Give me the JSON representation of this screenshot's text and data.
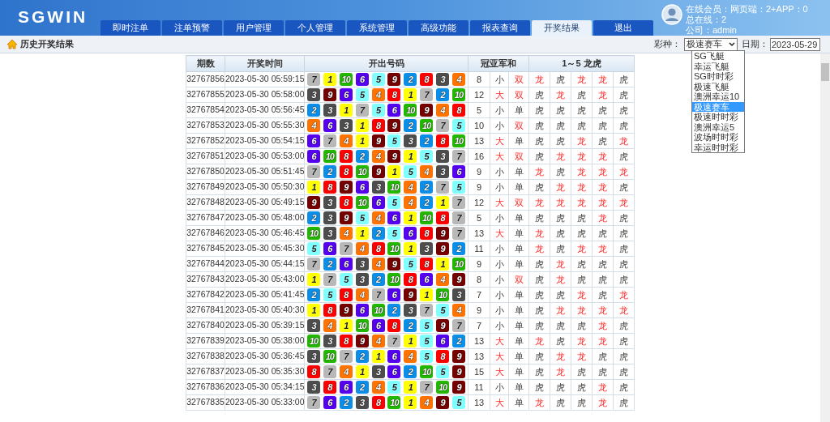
{
  "brand": {
    "logo": "SGWIN"
  },
  "nav_tabs": [
    {
      "label": "即时注单",
      "selected": false
    },
    {
      "label": "注单预警",
      "selected": false
    },
    {
      "label": "用户管理",
      "selected": false
    },
    {
      "label": "个人管理",
      "selected": false
    },
    {
      "label": "系统管理",
      "selected": false
    },
    {
      "label": "高级功能",
      "selected": false
    },
    {
      "label": "报表查询",
      "selected": false
    },
    {
      "label": "开奖结果",
      "selected": true
    },
    {
      "label": "退出",
      "selected": false
    }
  ],
  "user_info": [
    "在线会员：网页端：2+APP：0",
    "总在线：2",
    "公司：admin"
  ],
  "toolbar": {
    "title": "历史开奖结果",
    "lottery_label": "彩种：",
    "lottery_value": "极速赛车",
    "date_label": "日期：",
    "date_value": "2023-05-29"
  },
  "lottery_options": [
    {
      "label": "SG飞艇",
      "selected": false
    },
    {
      "label": "幸运飞艇",
      "selected": false
    },
    {
      "label": "SG时时彩",
      "selected": false
    },
    {
      "label": "极速飞艇",
      "selected": false
    },
    {
      "label": "澳洲幸运10",
      "selected": false
    },
    {
      "label": "极速赛车",
      "selected": true
    },
    {
      "label": "极速时时彩",
      "selected": false
    },
    {
      "label": "澳洲幸运5",
      "selected": false
    },
    {
      "label": "波场时时彩",
      "selected": false
    },
    {
      "label": "幸运时时彩",
      "selected": false
    }
  ],
  "table": {
    "columns": [
      "期数",
      "开奖时间",
      "开出号码",
      "冠亚军和",
      "1～5 龙虎"
    ],
    "rows": [
      {
        "issue": "32767856",
        "time": "2023-05-30 05:59:15",
        "balls": [
          {
            "label": "7",
            "color": "#b8b8b8"
          },
          {
            "label": "1",
            "color": "#ffff00"
          },
          {
            "label": "10",
            "color": "#22b800"
          },
          {
            "label": "6",
            "color": "#5500ee"
          },
          {
            "label": "5",
            "color": "#80ffff"
          },
          {
            "label": "9",
            "color": "#750000"
          },
          {
            "label": "2",
            "color": "#0b8ee8"
          },
          {
            "label": "8",
            "color": "#ff0000"
          },
          {
            "label": "3",
            "color": "#4d4d4d"
          },
          {
            "label": "4",
            "color": "#ff7300"
          }
        ],
        "sum": "8",
        "size": {
          "text": "小",
          "highlight": false
        },
        "parity": {
          "text": "双",
          "highlight": true
        },
        "dragon_tiger": [
          {
            "text": "龙",
            "highlight": true
          },
          {
            "text": "虎",
            "highlight": false
          },
          {
            "text": "龙",
            "highlight": true
          },
          {
            "text": "龙",
            "highlight": true
          },
          {
            "text": "虎",
            "highlight": false
          }
        ]
      },
      {
        "issue": "32767855",
        "time": "2023-05-30 05:58:00",
        "balls": [
          {
            "label": "3",
            "color": "#4d4d4d"
          },
          {
            "label": "9",
            "color": "#750000"
          },
          {
            "label": "6",
            "color": "#5500ee"
          },
          {
            "label": "5",
            "color": "#80ffff"
          },
          {
            "label": "4",
            "color": "#ff7300"
          },
          {
            "label": "8",
            "color": "#ff0000"
          },
          {
            "label": "1",
            "color": "#ffff00"
          },
          {
            "label": "7",
            "color": "#b8b8b8"
          },
          {
            "label": "2",
            "color": "#0b8ee8"
          },
          {
            "label": "10",
            "color": "#22b800"
          }
        ],
        "sum": "12",
        "size": {
          "text": "大",
          "highlight": true
        },
        "parity": {
          "text": "双",
          "highlight": true
        },
        "dragon_tiger": [
          {
            "text": "虎",
            "highlight": false
          },
          {
            "text": "龙",
            "highlight": true
          },
          {
            "text": "虎",
            "highlight": false
          },
          {
            "text": "龙",
            "highlight": true
          },
          {
            "text": "虎",
            "highlight": false
          }
        ]
      },
      {
        "issue": "32767854",
        "time": "2023-05-30 05:56:45",
        "balls": [
          {
            "label": "2",
            "color": "#0b8ee8"
          },
          {
            "label": "3",
            "color": "#4d4d4d"
          },
          {
            "label": "1",
            "color": "#ffff00"
          },
          {
            "label": "7",
            "color": "#b8b8b8"
          },
          {
            "label": "5",
            "color": "#80ffff"
          },
          {
            "label": "6",
            "color": "#5500ee"
          },
          {
            "label": "10",
            "color": "#22b800"
          },
          {
            "label": "9",
            "color": "#750000"
          },
          {
            "label": "4",
            "color": "#ff7300"
          },
          {
            "label": "8",
            "color": "#ff0000"
          }
        ],
        "sum": "5",
        "size": {
          "text": "小",
          "highlight": false
        },
        "parity": {
          "text": "单",
          "highlight": false
        },
        "dragon_tiger": [
          {
            "text": "虎",
            "highlight": false
          },
          {
            "text": "虎",
            "highlight": false
          },
          {
            "text": "虎",
            "highlight": false
          },
          {
            "text": "虎",
            "highlight": false
          },
          {
            "text": "虎",
            "highlight": false
          }
        ]
      },
      {
        "issue": "32767853",
        "time": "2023-05-30 05:55:30",
        "balls": [
          {
            "label": "4",
            "color": "#ff7300"
          },
          {
            "label": "6",
            "color": "#5500ee"
          },
          {
            "label": "3",
            "color": "#4d4d4d"
          },
          {
            "label": "1",
            "color": "#ffff00"
          },
          {
            "label": "8",
            "color": "#ff0000"
          },
          {
            "label": "9",
            "color": "#750000"
          },
          {
            "label": "2",
            "color": "#0b8ee8"
          },
          {
            "label": "10",
            "color": "#22b800"
          },
          {
            "label": "7",
            "color": "#b8b8b8"
          },
          {
            "label": "5",
            "color": "#80ffff"
          }
        ],
        "sum": "10",
        "size": {
          "text": "小",
          "highlight": false
        },
        "parity": {
          "text": "双",
          "highlight": true
        },
        "dragon_tiger": [
          {
            "text": "虎",
            "highlight": false
          },
          {
            "text": "虎",
            "highlight": false
          },
          {
            "text": "虎",
            "highlight": false
          },
          {
            "text": "虎",
            "highlight": false
          },
          {
            "text": "虎",
            "highlight": false
          }
        ]
      },
      {
        "issue": "32767852",
        "time": "2023-05-30 05:54:15",
        "balls": [
          {
            "label": "6",
            "color": "#5500ee"
          },
          {
            "label": "7",
            "color": "#b8b8b8"
          },
          {
            "label": "4",
            "color": "#ff7300"
          },
          {
            "label": "1",
            "color": "#ffff00"
          },
          {
            "label": "9",
            "color": "#750000"
          },
          {
            "label": "5",
            "color": "#80ffff"
          },
          {
            "label": "3",
            "color": "#4d4d4d"
          },
          {
            "label": "2",
            "color": "#0b8ee8"
          },
          {
            "label": "8",
            "color": "#ff0000"
          },
          {
            "label": "10",
            "color": "#22b800"
          }
        ],
        "sum": "13",
        "size": {
          "text": "大",
          "highlight": true
        },
        "parity": {
          "text": "单",
          "highlight": false
        },
        "dragon_tiger": [
          {
            "text": "虎",
            "highlight": false
          },
          {
            "text": "虎",
            "highlight": false
          },
          {
            "text": "龙",
            "highlight": true
          },
          {
            "text": "虎",
            "highlight": false
          },
          {
            "text": "龙",
            "highlight": true
          }
        ]
      },
      {
        "issue": "32767851",
        "time": "2023-05-30 05:53:00",
        "balls": [
          {
            "label": "6",
            "color": "#5500ee"
          },
          {
            "label": "10",
            "color": "#22b800"
          },
          {
            "label": "8",
            "color": "#ff0000"
          },
          {
            "label": "2",
            "color": "#0b8ee8"
          },
          {
            "label": "4",
            "color": "#ff7300"
          },
          {
            "label": "9",
            "color": "#750000"
          },
          {
            "label": "1",
            "color": "#ffff00"
          },
          {
            "label": "5",
            "color": "#80ffff"
          },
          {
            "label": "3",
            "color": "#4d4d4d"
          },
          {
            "label": "7",
            "color": "#b8b8b8"
          }
        ],
        "sum": "16",
        "size": {
          "text": "大",
          "highlight": true
        },
        "parity": {
          "text": "双",
          "highlight": true
        },
        "dragon_tiger": [
          {
            "text": "虎",
            "highlight": false
          },
          {
            "text": "龙",
            "highlight": true
          },
          {
            "text": "龙",
            "highlight": true
          },
          {
            "text": "龙",
            "highlight": true
          },
          {
            "text": "虎",
            "highlight": false
          }
        ]
      },
      {
        "issue": "32767850",
        "time": "2023-05-30 05:51:45",
        "balls": [
          {
            "label": "7",
            "color": "#b8b8b8"
          },
          {
            "label": "2",
            "color": "#0b8ee8"
          },
          {
            "label": "8",
            "color": "#ff0000"
          },
          {
            "label": "10",
            "color": "#22b800"
          },
          {
            "label": "9",
            "color": "#750000"
          },
          {
            "label": "1",
            "color": "#ffff00"
          },
          {
            "label": "5",
            "color": "#80ffff"
          },
          {
            "label": "4",
            "color": "#ff7300"
          },
          {
            "label": "3",
            "color": "#4d4d4d"
          },
          {
            "label": "6",
            "color": "#5500ee"
          }
        ],
        "sum": "9",
        "size": {
          "text": "小",
          "highlight": false
        },
        "parity": {
          "text": "单",
          "highlight": false
        },
        "dragon_tiger": [
          {
            "text": "龙",
            "highlight": true
          },
          {
            "text": "虎",
            "highlight": false
          },
          {
            "text": "龙",
            "highlight": true
          },
          {
            "text": "龙",
            "highlight": true
          },
          {
            "text": "龙",
            "highlight": true
          }
        ]
      },
      {
        "issue": "32767849",
        "time": "2023-05-30 05:50:30",
        "balls": [
          {
            "label": "1",
            "color": "#ffff00"
          },
          {
            "label": "8",
            "color": "#ff0000"
          },
          {
            "label": "9",
            "color": "#750000"
          },
          {
            "label": "6",
            "color": "#5500ee"
          },
          {
            "label": "3",
            "color": "#4d4d4d"
          },
          {
            "label": "10",
            "color": "#22b800"
          },
          {
            "label": "4",
            "color": "#ff7300"
          },
          {
            "label": "2",
            "color": "#0b8ee8"
          },
          {
            "label": "7",
            "color": "#b8b8b8"
          },
          {
            "label": "5",
            "color": "#80ffff"
          }
        ],
        "sum": "9",
        "size": {
          "text": "小",
          "highlight": false
        },
        "parity": {
          "text": "单",
          "highlight": false
        },
        "dragon_tiger": [
          {
            "text": "虎",
            "highlight": false
          },
          {
            "text": "龙",
            "highlight": true
          },
          {
            "text": "龙",
            "highlight": true
          },
          {
            "text": "龙",
            "highlight": true
          },
          {
            "text": "虎",
            "highlight": false
          }
        ]
      },
      {
        "issue": "32767848",
        "time": "2023-05-30 05:49:15",
        "balls": [
          {
            "label": "9",
            "color": "#750000"
          },
          {
            "label": "3",
            "color": "#4d4d4d"
          },
          {
            "label": "8",
            "color": "#ff0000"
          },
          {
            "label": "10",
            "color": "#22b800"
          },
          {
            "label": "6",
            "color": "#5500ee"
          },
          {
            "label": "5",
            "color": "#80ffff"
          },
          {
            "label": "4",
            "color": "#ff7300"
          },
          {
            "label": "2",
            "color": "#0b8ee8"
          },
          {
            "label": "1",
            "color": "#ffff00"
          },
          {
            "label": "7",
            "color": "#b8b8b8"
          }
        ],
        "sum": "12",
        "size": {
          "text": "大",
          "highlight": true
        },
        "parity": {
          "text": "双",
          "highlight": true
        },
        "dragon_tiger": [
          {
            "text": "龙",
            "highlight": true
          },
          {
            "text": "龙",
            "highlight": true
          },
          {
            "text": "龙",
            "highlight": true
          },
          {
            "text": "龙",
            "highlight": true
          },
          {
            "text": "龙",
            "highlight": true
          }
        ]
      },
      {
        "issue": "32767847",
        "time": "2023-05-30 05:48:00",
        "balls": [
          {
            "label": "2",
            "color": "#0b8ee8"
          },
          {
            "label": "3",
            "color": "#4d4d4d"
          },
          {
            "label": "9",
            "color": "#750000"
          },
          {
            "label": "5",
            "color": "#80ffff"
          },
          {
            "label": "4",
            "color": "#ff7300"
          },
          {
            "label": "6",
            "color": "#5500ee"
          },
          {
            "label": "1",
            "color": "#ffff00"
          },
          {
            "label": "10",
            "color": "#22b800"
          },
          {
            "label": "8",
            "color": "#ff0000"
          },
          {
            "label": "7",
            "color": "#b8b8b8"
          }
        ],
        "sum": "5",
        "size": {
          "text": "小",
          "highlight": false
        },
        "parity": {
          "text": "单",
          "highlight": false
        },
        "dragon_tiger": [
          {
            "text": "虎",
            "highlight": false
          },
          {
            "text": "虎",
            "highlight": false
          },
          {
            "text": "虎",
            "highlight": false
          },
          {
            "text": "龙",
            "highlight": true
          },
          {
            "text": "虎",
            "highlight": false
          }
        ]
      },
      {
        "issue": "32767846",
        "time": "2023-05-30 05:46:45",
        "balls": [
          {
            "label": "10",
            "color": "#22b800"
          },
          {
            "label": "3",
            "color": "#4d4d4d"
          },
          {
            "label": "4",
            "color": "#ff7300"
          },
          {
            "label": "1",
            "color": "#ffff00"
          },
          {
            "label": "2",
            "color": "#0b8ee8"
          },
          {
            "label": "5",
            "color": "#80ffff"
          },
          {
            "label": "6",
            "color": "#5500ee"
          },
          {
            "label": "8",
            "color": "#ff0000"
          },
          {
            "label": "9",
            "color": "#750000"
          },
          {
            "label": "7",
            "color": "#b8b8b8"
          }
        ],
        "sum": "13",
        "size": {
          "text": "大",
          "highlight": true
        },
        "parity": {
          "text": "单",
          "highlight": false
        },
        "dragon_tiger": [
          {
            "text": "龙",
            "highlight": true
          },
          {
            "text": "虎",
            "highlight": false
          },
          {
            "text": "虎",
            "highlight": false
          },
          {
            "text": "虎",
            "highlight": false
          },
          {
            "text": "虎",
            "highlight": false
          }
        ]
      },
      {
        "issue": "32767845",
        "time": "2023-05-30 05:45:30",
        "balls": [
          {
            "label": "5",
            "color": "#80ffff"
          },
          {
            "label": "6",
            "color": "#5500ee"
          },
          {
            "label": "7",
            "color": "#b8b8b8"
          },
          {
            "label": "4",
            "color": "#ff7300"
          },
          {
            "label": "8",
            "color": "#ff0000"
          },
          {
            "label": "10",
            "color": "#22b800"
          },
          {
            "label": "1",
            "color": "#ffff00"
          },
          {
            "label": "3",
            "color": "#4d4d4d"
          },
          {
            "label": "9",
            "color": "#750000"
          },
          {
            "label": "2",
            "color": "#0b8ee8"
          }
        ],
        "sum": "11",
        "size": {
          "text": "小",
          "highlight": false
        },
        "parity": {
          "text": "单",
          "highlight": false
        },
        "dragon_tiger": [
          {
            "text": "龙",
            "highlight": true
          },
          {
            "text": "虎",
            "highlight": false
          },
          {
            "text": "龙",
            "highlight": true
          },
          {
            "text": "龙",
            "highlight": true
          },
          {
            "text": "虎",
            "highlight": false
          }
        ]
      },
      {
        "issue": "32767844",
        "time": "2023-05-30 05:44:15",
        "balls": [
          {
            "label": "7",
            "color": "#b8b8b8"
          },
          {
            "label": "2",
            "color": "#0b8ee8"
          },
          {
            "label": "6",
            "color": "#5500ee"
          },
          {
            "label": "3",
            "color": "#4d4d4d"
          },
          {
            "label": "4",
            "color": "#ff7300"
          },
          {
            "label": "9",
            "color": "#750000"
          },
          {
            "label": "5",
            "color": "#80ffff"
          },
          {
            "label": "8",
            "color": "#ff0000"
          },
          {
            "label": "1",
            "color": "#ffff00"
          },
          {
            "label": "10",
            "color": "#22b800"
          }
        ],
        "sum": "9",
        "size": {
          "text": "小",
          "highlight": false
        },
        "parity": {
          "text": "单",
          "highlight": false
        },
        "dragon_tiger": [
          {
            "text": "虎",
            "highlight": false
          },
          {
            "text": "龙",
            "highlight": true
          },
          {
            "text": "虎",
            "highlight": false
          },
          {
            "text": "虎",
            "highlight": false
          },
          {
            "text": "虎",
            "highlight": false
          }
        ]
      },
      {
        "issue": "32767843",
        "time": "2023-05-30 05:43:00",
        "balls": [
          {
            "label": "1",
            "color": "#ffff00"
          },
          {
            "label": "7",
            "color": "#b8b8b8"
          },
          {
            "label": "5",
            "color": "#80ffff"
          },
          {
            "label": "3",
            "color": "#4d4d4d"
          },
          {
            "label": "2",
            "color": "#0b8ee8"
          },
          {
            "label": "10",
            "color": "#22b800"
          },
          {
            "label": "8",
            "color": "#ff0000"
          },
          {
            "label": "6",
            "color": "#5500ee"
          },
          {
            "label": "4",
            "color": "#ff7300"
          },
          {
            "label": "9",
            "color": "#750000"
          }
        ],
        "sum": "8",
        "size": {
          "text": "小",
          "highlight": false
        },
        "parity": {
          "text": "双",
          "highlight": true
        },
        "dragon_tiger": [
          {
            "text": "虎",
            "highlight": false
          },
          {
            "text": "龙",
            "highlight": true
          },
          {
            "text": "虎",
            "highlight": false
          },
          {
            "text": "虎",
            "highlight": false
          },
          {
            "text": "虎",
            "highlight": false
          }
        ]
      },
      {
        "issue": "32767842",
        "time": "2023-05-30 05:41:45",
        "balls": [
          {
            "label": "2",
            "color": "#0b8ee8"
          },
          {
            "label": "5",
            "color": "#80ffff"
          },
          {
            "label": "8",
            "color": "#ff0000"
          },
          {
            "label": "4",
            "color": "#ff7300"
          },
          {
            "label": "7",
            "color": "#b8b8b8"
          },
          {
            "label": "6",
            "color": "#5500ee"
          },
          {
            "label": "9",
            "color": "#750000"
          },
          {
            "label": "1",
            "color": "#ffff00"
          },
          {
            "label": "10",
            "color": "#22b800"
          },
          {
            "label": "3",
            "color": "#4d4d4d"
          }
        ],
        "sum": "7",
        "size": {
          "text": "小",
          "highlight": false
        },
        "parity": {
          "text": "单",
          "highlight": false
        },
        "dragon_tiger": [
          {
            "text": "虎",
            "highlight": false
          },
          {
            "text": "虎",
            "highlight": false
          },
          {
            "text": "龙",
            "highlight": true
          },
          {
            "text": "虎",
            "highlight": false
          },
          {
            "text": "龙",
            "highlight": true
          }
        ]
      },
      {
        "issue": "32767841",
        "time": "2023-05-30 05:40:30",
        "balls": [
          {
            "label": "1",
            "color": "#ffff00"
          },
          {
            "label": "8",
            "color": "#ff0000"
          },
          {
            "label": "9",
            "color": "#750000"
          },
          {
            "label": "6",
            "color": "#5500ee"
          },
          {
            "label": "10",
            "color": "#22b800"
          },
          {
            "label": "2",
            "color": "#0b8ee8"
          },
          {
            "label": "3",
            "color": "#4d4d4d"
          },
          {
            "label": "7",
            "color": "#b8b8b8"
          },
          {
            "label": "5",
            "color": "#80ffff"
          },
          {
            "label": "4",
            "color": "#ff7300"
          }
        ],
        "sum": "9",
        "size": {
          "text": "小",
          "highlight": false
        },
        "parity": {
          "text": "单",
          "highlight": false
        },
        "dragon_tiger": [
          {
            "text": "虎",
            "highlight": false
          },
          {
            "text": "龙",
            "highlight": true
          },
          {
            "text": "龙",
            "highlight": true
          },
          {
            "text": "龙",
            "highlight": true
          },
          {
            "text": "龙",
            "highlight": true
          }
        ]
      },
      {
        "issue": "32767840",
        "time": "2023-05-30 05:39:15",
        "balls": [
          {
            "label": "3",
            "color": "#4d4d4d"
          },
          {
            "label": "4",
            "color": "#ff7300"
          },
          {
            "label": "1",
            "color": "#ffff00"
          },
          {
            "label": "10",
            "color": "#22b800"
          },
          {
            "label": "6",
            "color": "#5500ee"
          },
          {
            "label": "8",
            "color": "#ff0000"
          },
          {
            "label": "2",
            "color": "#0b8ee8"
          },
          {
            "label": "5",
            "color": "#80ffff"
          },
          {
            "label": "9",
            "color": "#750000"
          },
          {
            "label": "7",
            "color": "#b8b8b8"
          }
        ],
        "sum": "7",
        "size": {
          "text": "小",
          "highlight": false
        },
        "parity": {
          "text": "单",
          "highlight": false
        },
        "dragon_tiger": [
          {
            "text": "虎",
            "highlight": false
          },
          {
            "text": "虎",
            "highlight": false
          },
          {
            "text": "虎",
            "highlight": false
          },
          {
            "text": "龙",
            "highlight": true
          },
          {
            "text": "虎",
            "highlight": false
          }
        ]
      },
      {
        "issue": "32767839",
        "time": "2023-05-30 05:38:00",
        "balls": [
          {
            "label": "10",
            "color": "#22b800"
          },
          {
            "label": "3",
            "color": "#4d4d4d"
          },
          {
            "label": "8",
            "color": "#ff0000"
          },
          {
            "label": "9",
            "color": "#750000"
          },
          {
            "label": "4",
            "color": "#ff7300"
          },
          {
            "label": "7",
            "color": "#b8b8b8"
          },
          {
            "label": "1",
            "color": "#ffff00"
          },
          {
            "label": "5",
            "color": "#80ffff"
          },
          {
            "label": "6",
            "color": "#5500ee"
          },
          {
            "label": "2",
            "color": "#0b8ee8"
          }
        ],
        "sum": "13",
        "size": {
          "text": "大",
          "highlight": true
        },
        "parity": {
          "text": "单",
          "highlight": false
        },
        "dragon_tiger": [
          {
            "text": "龙",
            "highlight": true
          },
          {
            "text": "虎",
            "highlight": false
          },
          {
            "text": "龙",
            "highlight": true
          },
          {
            "text": "龙",
            "highlight": true
          },
          {
            "text": "虎",
            "highlight": false
          }
        ]
      },
      {
        "issue": "32767838",
        "time": "2023-05-30 05:36:45",
        "balls": [
          {
            "label": "3",
            "color": "#4d4d4d"
          },
          {
            "label": "10",
            "color": "#22b800"
          },
          {
            "label": "7",
            "color": "#b8b8b8"
          },
          {
            "label": "2",
            "color": "#0b8ee8"
          },
          {
            "label": "1",
            "color": "#ffff00"
          },
          {
            "label": "6",
            "color": "#5500ee"
          },
          {
            "label": "4",
            "color": "#ff7300"
          },
          {
            "label": "5",
            "color": "#80ffff"
          },
          {
            "label": "8",
            "color": "#ff0000"
          },
          {
            "label": "9",
            "color": "#750000"
          }
        ],
        "sum": "13",
        "size": {
          "text": "大",
          "highlight": true
        },
        "parity": {
          "text": "单",
          "highlight": false
        },
        "dragon_tiger": [
          {
            "text": "虎",
            "highlight": false
          },
          {
            "text": "龙",
            "highlight": true
          },
          {
            "text": "龙",
            "highlight": true
          },
          {
            "text": "虎",
            "highlight": false
          },
          {
            "text": "虎",
            "highlight": false
          }
        ]
      },
      {
        "issue": "32767837",
        "time": "2023-05-30 05:35:30",
        "balls": [
          {
            "label": "8",
            "color": "#ff0000"
          },
          {
            "label": "7",
            "color": "#b8b8b8"
          },
          {
            "label": "4",
            "color": "#ff7300"
          },
          {
            "label": "1",
            "color": "#ffff00"
          },
          {
            "label": "3",
            "color": "#4d4d4d"
          },
          {
            "label": "6",
            "color": "#5500ee"
          },
          {
            "label": "2",
            "color": "#0b8ee8"
          },
          {
            "label": "10",
            "color": "#22b800"
          },
          {
            "label": "5",
            "color": "#80ffff"
          },
          {
            "label": "9",
            "color": "#750000"
          }
        ],
        "sum": "15",
        "size": {
          "text": "大",
          "highlight": true
        },
        "parity": {
          "text": "单",
          "highlight": false
        },
        "dragon_tiger": [
          {
            "text": "虎",
            "highlight": false
          },
          {
            "text": "龙",
            "highlight": true
          },
          {
            "text": "虎",
            "highlight": false
          },
          {
            "text": "虎",
            "highlight": false
          },
          {
            "text": "虎",
            "highlight": false
          }
        ]
      },
      {
        "issue": "32767836",
        "time": "2023-05-30 05:34:15",
        "balls": [
          {
            "label": "3",
            "color": "#4d4d4d"
          },
          {
            "label": "8",
            "color": "#ff0000"
          },
          {
            "label": "6",
            "color": "#5500ee"
          },
          {
            "label": "2",
            "color": "#0b8ee8"
          },
          {
            "label": "4",
            "color": "#ff7300"
          },
          {
            "label": "5",
            "color": "#80ffff"
          },
          {
            "label": "1",
            "color": "#ffff00"
          },
          {
            "label": "7",
            "color": "#b8b8b8"
          },
          {
            "label": "10",
            "color": "#22b800"
          },
          {
            "label": "9",
            "color": "#750000"
          }
        ],
        "sum": "11",
        "size": {
          "text": "小",
          "highlight": false
        },
        "parity": {
          "text": "单",
          "highlight": false
        },
        "dragon_tiger": [
          {
            "text": "虎",
            "highlight": false
          },
          {
            "text": "虎",
            "highlight": false
          },
          {
            "text": "虎",
            "highlight": false
          },
          {
            "text": "龙",
            "highlight": true
          },
          {
            "text": "虎",
            "highlight": false
          }
        ]
      },
      {
        "issue": "32767835",
        "time": "2023-05-30 05:33:00",
        "balls": [
          {
            "label": "7",
            "color": "#b8b8b8"
          },
          {
            "label": "6",
            "color": "#5500ee"
          },
          {
            "label": "2",
            "color": "#0b8ee8"
          },
          {
            "label": "3",
            "color": "#4d4d4d"
          },
          {
            "label": "8",
            "color": "#ff0000"
          },
          {
            "label": "10",
            "color": "#22b800"
          },
          {
            "label": "1",
            "color": "#ffff00"
          },
          {
            "label": "4",
            "color": "#ff7300"
          },
          {
            "label": "9",
            "color": "#750000"
          },
          {
            "label": "5",
            "color": "#80ffff"
          }
        ],
        "sum": "13",
        "size": {
          "text": "大",
          "highlight": true
        },
        "parity": {
          "text": "单",
          "highlight": false
        },
        "dragon_tiger": [
          {
            "text": "龙",
            "highlight": true
          },
          {
            "text": "虎",
            "highlight": false
          },
          {
            "text": "虎",
            "highlight": false
          },
          {
            "text": "龙",
            "highlight": true
          },
          {
            "text": "虎",
            "highlight": false
          }
        ]
      }
    ]
  }
}
